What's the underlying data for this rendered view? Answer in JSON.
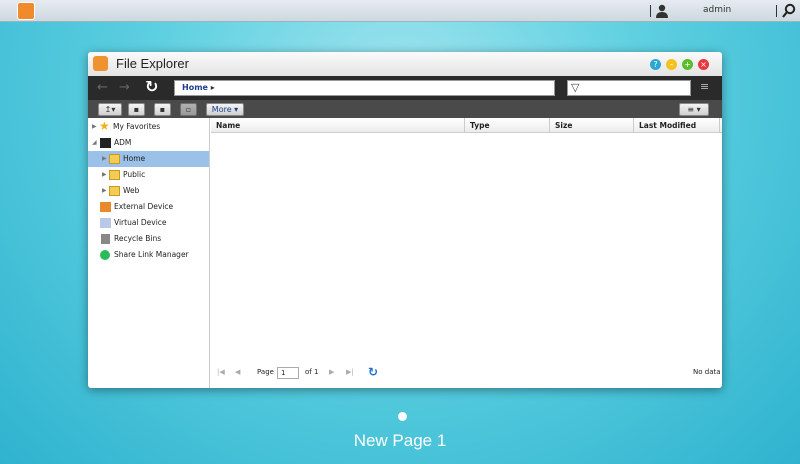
{
  "topbar": {
    "user": "admin",
    "icons": [
      "app-icon",
      "user-icon",
      "search-icon"
    ]
  },
  "window": {
    "title": "File Explorer",
    "controls": [
      "help",
      "minimize",
      "maximize",
      "close"
    ],
    "address": {
      "path": "Home",
      "separator": "▸"
    },
    "filter_placeholder": "",
    "toolbar": {
      "more_label": "More"
    },
    "sidebar": [
      {
        "label": "My Favorites",
        "icon": "star-icon"
      },
      {
        "label": "ADM",
        "icon": "nas-icon"
      },
      {
        "label": "Home",
        "icon": "folder-icon",
        "selected": true
      },
      {
        "label": "Public",
        "icon": "folder-icon"
      },
      {
        "label": "Web",
        "icon": "folder-icon"
      },
      {
        "label": "External Device",
        "icon": "external-device-icon"
      },
      {
        "label": "Virtual Device",
        "icon": "virtual-device-icon"
      },
      {
        "label": "Recycle Bins",
        "icon": "trash-icon"
      },
      {
        "label": "Share Link Manager",
        "icon": "share-icon"
      }
    ],
    "columns": [
      "Name",
      "Type",
      "Size",
      "Last Modified"
    ],
    "pager": {
      "page_label": "Page",
      "page": "1",
      "of_label": "of 1",
      "status": "No data"
    }
  },
  "desktop": {
    "page_name": "New Page 1"
  }
}
